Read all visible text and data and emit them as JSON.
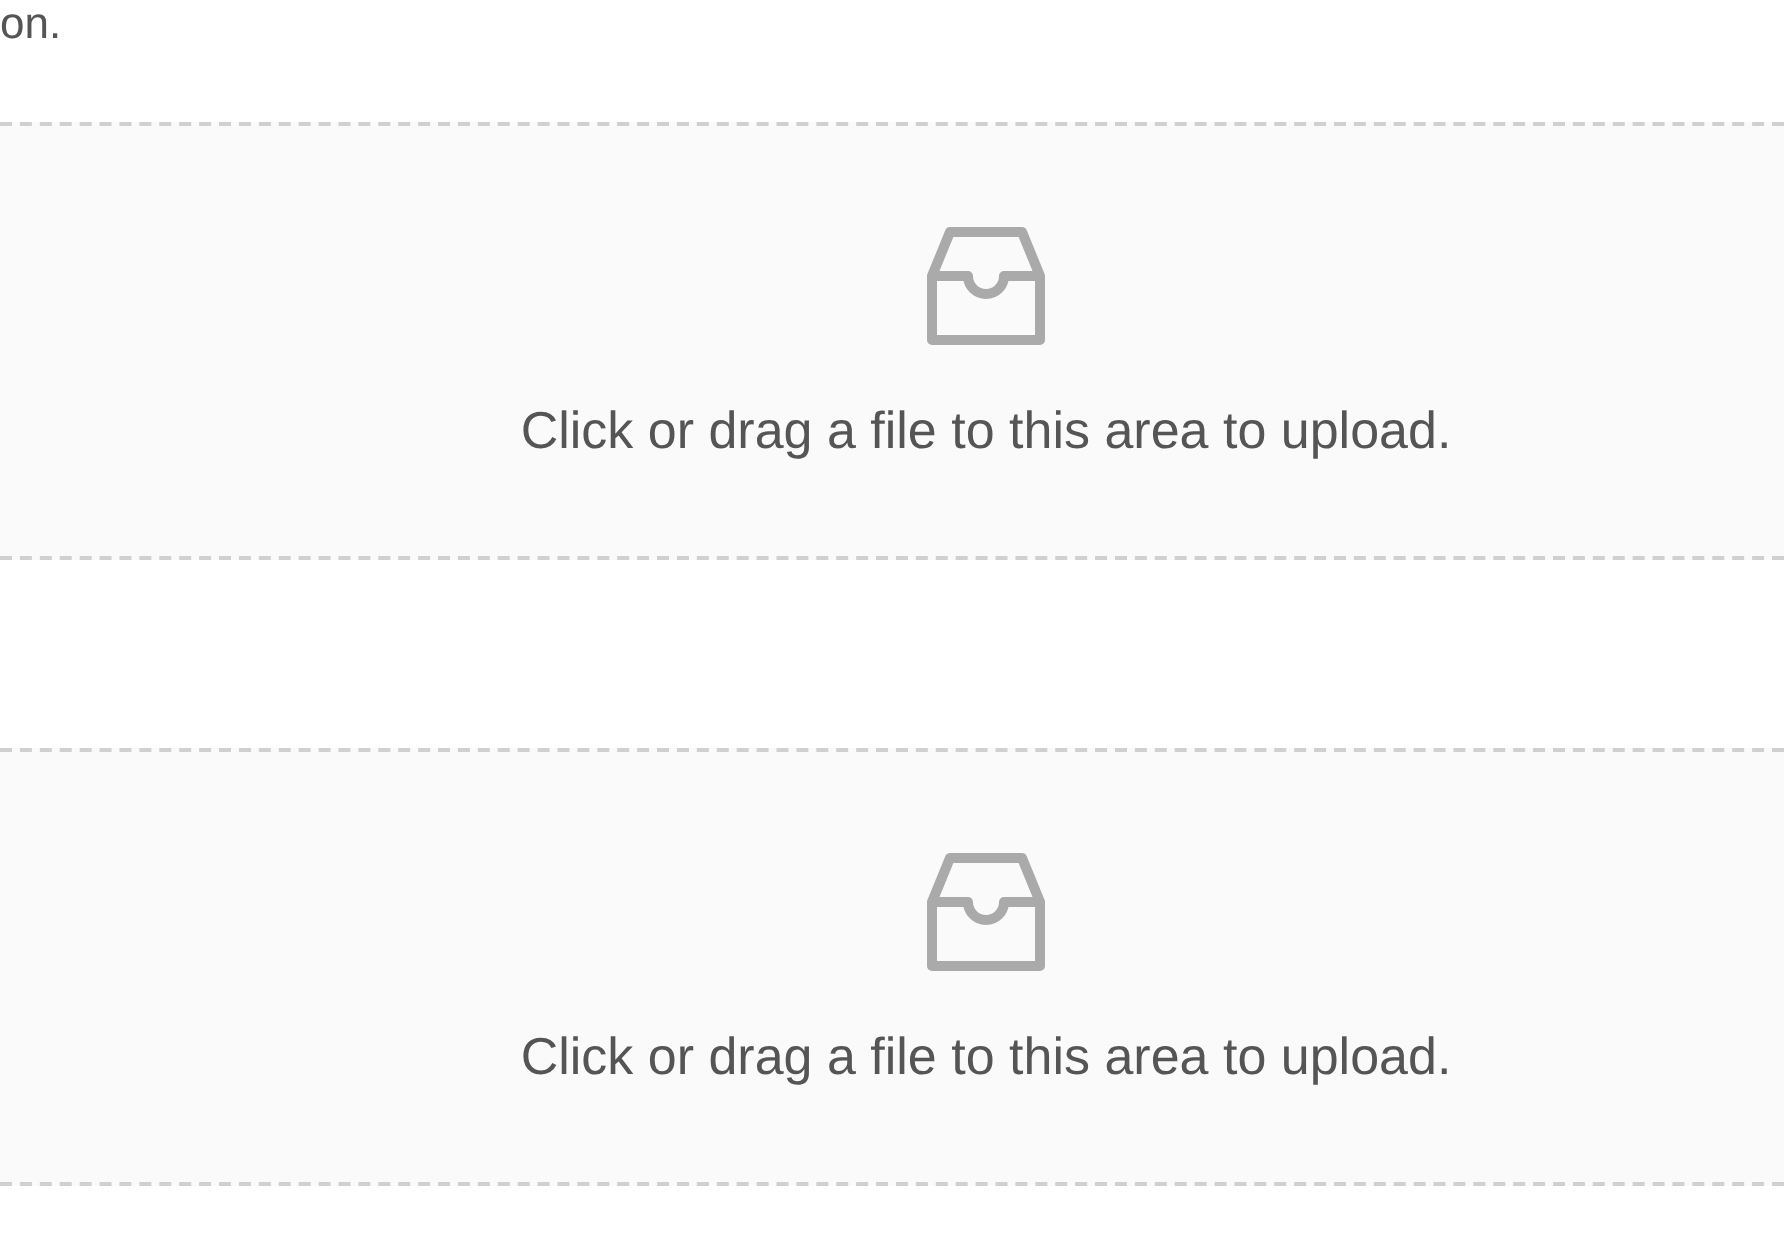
{
  "intro_text": "on.",
  "upload_areas": [
    {
      "hint": "Click or drag a file to this area to upload."
    },
    {
      "hint": "Click or drag a file to this area to upload."
    }
  ]
}
